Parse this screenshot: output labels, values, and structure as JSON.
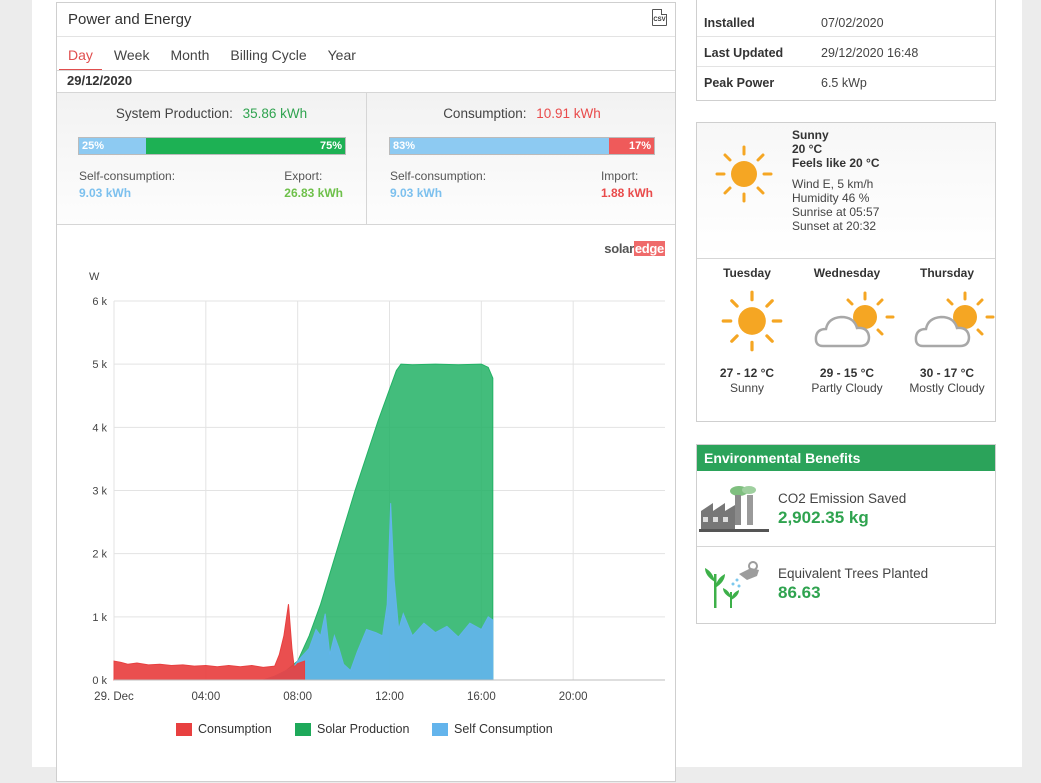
{
  "power_energy": {
    "title": "Power and Energy",
    "csv_label": "CSV",
    "tabs": [
      "Day",
      "Week",
      "Month",
      "Billing Cycle",
      "Year"
    ],
    "active_tab": "Day",
    "date": "29/12/2020",
    "production": {
      "label": "System Production:",
      "value": "35.86 kWh",
      "bar_left_pct": "25%",
      "bar_right_pct": "75%",
      "bar_left_fraction": 0.25,
      "left_label": "Self-consumption:",
      "left_value": "9.03 kWh",
      "right_label": "Export:",
      "right_value": "26.83 kWh"
    },
    "consumption": {
      "label": "Consumption:",
      "value": "10.91 kWh",
      "bar_left_pct": "83%",
      "bar_right_pct": "17%",
      "bar_left_fraction": 0.83,
      "left_label": "Self-consumption:",
      "left_value": "9.03 kWh",
      "right_label": "Import:",
      "right_value": "1.88 kWh"
    },
    "logo": {
      "part1": "solar",
      "part2": "edge"
    }
  },
  "chart_data": {
    "type": "area",
    "ylabel": "W",
    "y_ticks": [
      "0 k",
      "1 k",
      "2 k",
      "3 k",
      "4 k",
      "5 k",
      "6 k"
    ],
    "x_ticks": [
      "29. Dec",
      "04:00",
      "08:00",
      "12:00",
      "16:00",
      "20:00"
    ],
    "ylim": [
      0,
      6000
    ],
    "xlim_hours": [
      0,
      24
    ],
    "grid": true,
    "legend_position": "bottom",
    "series": [
      {
        "name": "Consumption",
        "color": "#e84040",
        "points": [
          [
            0,
            300
          ],
          [
            0.3,
            280
          ],
          [
            0.6,
            250
          ],
          [
            1,
            270
          ],
          [
            1.5,
            240
          ],
          [
            2,
            250
          ],
          [
            2.5,
            230
          ],
          [
            3,
            240
          ],
          [
            3.5,
            220
          ],
          [
            4,
            230
          ],
          [
            4.5,
            210
          ],
          [
            5,
            230
          ],
          [
            5.5,
            210
          ],
          [
            6,
            230
          ],
          [
            6.5,
            200
          ],
          [
            7,
            220
          ],
          [
            7.2,
            400
          ],
          [
            7.4,
            700
          ],
          [
            7.6,
            1200
          ],
          [
            7.75,
            500
          ],
          [
            7.85,
            200
          ],
          [
            8,
            260
          ],
          [
            8.3,
            300
          ]
        ]
      },
      {
        "name": "Solar Production",
        "color": "#22b265",
        "points": [
          [
            6.5,
            0
          ],
          [
            7,
            60
          ],
          [
            7.5,
            150
          ],
          [
            8,
            300
          ],
          [
            8.5,
            700
          ],
          [
            9,
            1200
          ],
          [
            9.5,
            1800
          ],
          [
            10,
            2400
          ],
          [
            10.5,
            3000
          ],
          [
            11,
            3550
          ],
          [
            11.5,
            4100
          ],
          [
            12,
            4600
          ],
          [
            12.3,
            4900
          ],
          [
            12.5,
            5000
          ],
          [
            13,
            4990
          ],
          [
            14,
            5000
          ],
          [
            15,
            4990
          ],
          [
            16,
            5000
          ],
          [
            16.3,
            4950
          ],
          [
            16.5,
            4780
          ],
          [
            16.5,
            0
          ]
        ]
      },
      {
        "name": "Self Consumption",
        "color": "#63b4ec",
        "points": [
          [
            6.5,
            0
          ],
          [
            7,
            60
          ],
          [
            7.5,
            150
          ],
          [
            7.8,
            200
          ],
          [
            8,
            300
          ],
          [
            8.5,
            500
          ],
          [
            8.8,
            800
          ],
          [
            9,
            700
          ],
          [
            9.2,
            1050
          ],
          [
            9.4,
            400
          ],
          [
            9.6,
            700
          ],
          [
            9.8,
            500
          ],
          [
            10,
            250
          ],
          [
            10.3,
            150
          ],
          [
            10.6,
            450
          ],
          [
            11,
            800
          ],
          [
            11.4,
            750
          ],
          [
            11.7,
            700
          ],
          [
            11.9,
            1200
          ],
          [
            12.05,
            2800
          ],
          [
            12.2,
            1600
          ],
          [
            12.4,
            800
          ],
          [
            12.6,
            1050
          ],
          [
            13,
            700
          ],
          [
            13.5,
            900
          ],
          [
            14,
            750
          ],
          [
            14.5,
            850
          ],
          [
            15,
            680
          ],
          [
            15.5,
            900
          ],
          [
            16,
            800
          ],
          [
            16.3,
            1000
          ],
          [
            16.5,
            950
          ],
          [
            16.5,
            0
          ]
        ]
      }
    ]
  },
  "legend": [
    "Consumption",
    "Solar Production",
    "Self Consumption"
  ],
  "site_info": {
    "rows": [
      {
        "key": "Installed",
        "value": "07/02/2020"
      },
      {
        "key": "Last Updated",
        "value": "29/12/2020 16:48"
      },
      {
        "key": "Peak Power",
        "value": "6.5 kWp"
      }
    ]
  },
  "weather": {
    "condition": "Sunny",
    "temp": "20 °C",
    "feels_like": "Feels like 20 °C",
    "wind": "Wind E, 5 km/h",
    "humidity": "Humidity 46 %",
    "sunrise": "Sunrise at 05:57",
    "sunset": "Sunset at 20:32",
    "current_icon": "sun-icon",
    "forecast": [
      {
        "day": "Tuesday",
        "temp": "27 - 12 °C",
        "desc": "Sunny",
        "icon": "sun-icon"
      },
      {
        "day": "Wednesday",
        "temp": "29 - 15 °C",
        "desc": "Partly Cloudy",
        "icon": "partly-cloudy-icon"
      },
      {
        "day": "Thursday",
        "temp": "30 - 17 °C",
        "desc": "Mostly Cloudy",
        "icon": "mostly-cloudy-icon"
      }
    ]
  },
  "environment": {
    "title": "Environmental Benefits",
    "co2_label": "CO2 Emission Saved",
    "co2_value": "2,902.35 kg",
    "co2_icon": "factory-icon",
    "trees_label": "Equivalent Trees Planted",
    "trees_value": "86.63",
    "trees_icon": "tree-watering-icon"
  },
  "colors": {
    "accent_red": "#e04e4e",
    "green": "#2ba35a",
    "blue": "#63b4ec"
  }
}
